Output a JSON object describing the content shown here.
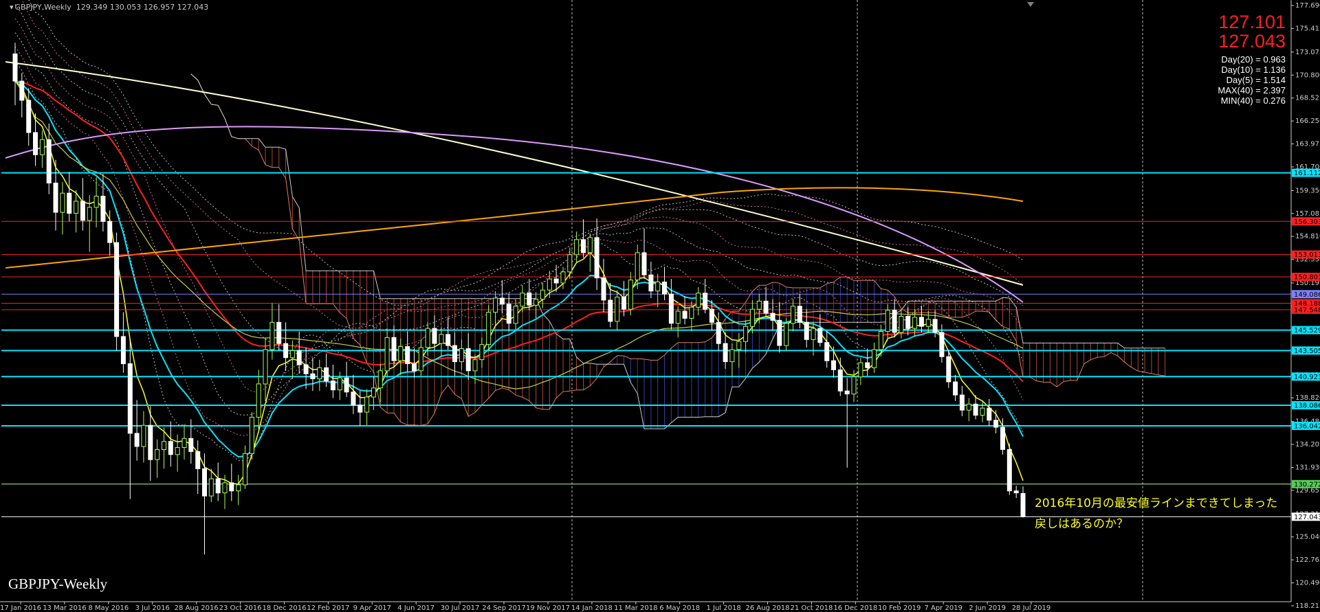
{
  "header": {
    "symbol": "GBPJPY,Weekly",
    "ohlc": "129.349 130.053 126.957 127.043"
  },
  "price_panel": {
    "bid": "127.101",
    "ask": "127.043",
    "stats": [
      "Day(20) = 0.963",
      "Day(10) = 1.136",
      "Day(5) = 1.514",
      "MAX(40) = 2.397",
      "MIN(40) = 0.276"
    ]
  },
  "watermark": "GBPJPY-Weekly",
  "annotations": {
    "line1": "2016年10月の最安値ラインまできてしまった",
    "line2": "戻しはあるのか？"
  },
  "colors": {
    "background": "#000000",
    "bull": "#aaff55",
    "bear": "#ffffff",
    "cyan": "#00e5ff",
    "red_line": "#ff2020",
    "yellow_line": "#ffff20",
    "orange_line": "#ffa500",
    "violet_line": "#dd99ff",
    "cream_line": "#ffffd0",
    "annotation": "#ffff1a"
  },
  "chart_data": {
    "type": "candlestick",
    "title": "GBPJPY,Weekly",
    "ylim": [
      118.0,
      178.0
    ],
    "x_tick_labels": [
      "17 Jan 2016",
      "13 Mar 2016",
      "8 May 2016",
      "3 Jul 2016",
      "28 Aug 2016",
      "23 Oct 2016",
      "18 Dec 2016",
      "12 Feb 2017",
      "9 Apr 2017",
      "4 Jun 2017",
      "30 Jul 2017",
      "24 Sep 2017",
      "19 Nov 2017",
      "14 Jan 2018",
      "11 Mar 2018",
      "6 May 2018",
      "1 Jul 2018",
      "26 Aug 2018",
      "21 Oct 2018",
      "16 Dec 2018",
      "10 Feb 2019",
      "7 Apr 2019",
      "2 Jun 2019",
      "28 Jul 2019"
    ],
    "y_ticks": [
      177.69,
      175.415,
      173.075,
      170.8,
      168.525,
      166.25,
      163.975,
      161.7,
      159.35,
      157.085,
      154.81,
      152.535,
      150.195,
      147.92,
      145.645,
      143.37,
      141.095,
      138.82,
      136.48,
      134.205,
      131.93,
      129.655,
      127.315,
      125.04,
      122.765,
      120.49,
      118.215
    ],
    "horizontal_levels": [
      {
        "price": 161.112,
        "label": "161.112",
        "color": "#00e5ff"
      },
      {
        "price": 156.303,
        "label": "156.303",
        "color": "#ff2020"
      },
      {
        "price": 153.013,
        "label": "153.013",
        "color": "#ff2020"
      },
      {
        "price": 150.801,
        "label": "150.801",
        "color": "#ff2020"
      },
      {
        "price": 149.086,
        "label": "149.086",
        "color": "#7f7fff"
      },
      {
        "price": 148.188,
        "label": "148.188",
        "color": "#ff2020"
      },
      {
        "price": 147.548,
        "label": "147.548",
        "color": "#ff2020"
      },
      {
        "price": 145.529,
        "label": "145.529",
        "color": "#00e5ff"
      },
      {
        "price": 143.505,
        "label": "143.505",
        "color": "#00e5ff"
      },
      {
        "price": 140.921,
        "label": "140.921",
        "color": "#00e5ff"
      },
      {
        "price": 138.086,
        "label": "138.086",
        "color": "#00e5ff"
      },
      {
        "price": 136.042,
        "label": "136.042",
        "color": "#00e5ff"
      },
      {
        "price": 130.272,
        "label": "130.272",
        "color": "#aaffaa"
      },
      {
        "price": 127.043,
        "label": "127.043",
        "color": "#ffffff"
      }
    ],
    "ohlc": [
      [
        172.9,
        174.0,
        167.8,
        170.2
      ],
      [
        170.2,
        171.0,
        166.6,
        168.3
      ],
      [
        168.3,
        169.5,
        163.8,
        165.1
      ],
      [
        165.1,
        167.0,
        161.8,
        162.9
      ],
      [
        162.9,
        165.3,
        161.6,
        164.4
      ],
      [
        164.4,
        166.0,
        159.0,
        160.1
      ],
      [
        160.1,
        162.4,
        155.4,
        157.2
      ],
      [
        157.2,
        160.2,
        155.0,
        159.1
      ],
      [
        159.1,
        161.2,
        156.3,
        157.1
      ],
      [
        157.1,
        159.4,
        155.2,
        158.3
      ],
      [
        158.3,
        160.6,
        155.4,
        156.4
      ],
      [
        156.4,
        158.9,
        153.3,
        157.7
      ],
      [
        157.7,
        160.7,
        155.7,
        158.8
      ],
      [
        158.8,
        161.0,
        155.3,
        156.3
      ],
      [
        156.3,
        157.4,
        152.9,
        154.2
      ],
      [
        154.2,
        155.2,
        143.5,
        144.9
      ],
      [
        144.9,
        147.3,
        141.3,
        142.2
      ],
      [
        142.2,
        144.6,
        128.8,
        135.3
      ],
      [
        135.3,
        138.6,
        132.6,
        134.0
      ],
      [
        134.0,
        137.5,
        132.4,
        136.1
      ],
      [
        136.1,
        138.0,
        130.6,
        132.7
      ],
      [
        132.7,
        134.7,
        130.9,
        133.7
      ],
      [
        133.7,
        135.9,
        131.8,
        134.5
      ],
      [
        134.5,
        136.5,
        132.0,
        133.2
      ],
      [
        133.2,
        135.2,
        131.5,
        133.9
      ],
      [
        133.9,
        136.2,
        132.7,
        134.8
      ],
      [
        134.8,
        136.7,
        132.3,
        133.5
      ],
      [
        133.5,
        134.6,
        129.3,
        131.8
      ],
      [
        131.8,
        133.3,
        123.3,
        129.1
      ],
      [
        129.1,
        131.8,
        128.5,
        130.8
      ],
      [
        130.8,
        132.4,
        128.6,
        129.4
      ],
      [
        129.4,
        131.2,
        127.8,
        130.4
      ],
      [
        130.4,
        132.3,
        128.6,
        129.6
      ],
      [
        129.6,
        131.2,
        128.2,
        130.2
      ],
      [
        130.2,
        134.1,
        129.8,
        133.3
      ],
      [
        133.3,
        137.4,
        132.7,
        136.9
      ],
      [
        136.9,
        141.6,
        135.4,
        140.2
      ],
      [
        140.2,
        144.8,
        138.5,
        143.6
      ],
      [
        143.6,
        148.2,
        142.6,
        146.3
      ],
      [
        146.3,
        148.1,
        143.5,
        144.2
      ],
      [
        144.2,
        146.3,
        141.5,
        142.8
      ],
      [
        142.8,
        144.5,
        140.7,
        143.5
      ],
      [
        143.5,
        145.4,
        141.2,
        142.1
      ],
      [
        142.1,
        143.8,
        139.7,
        141.2
      ],
      [
        141.2,
        142.8,
        139.5,
        140.7
      ],
      [
        140.7,
        142.6,
        139.5,
        141.8
      ],
      [
        141.8,
        143.2,
        139.9,
        140.5
      ],
      [
        140.5,
        142.1,
        138.8,
        139.6
      ],
      [
        139.6,
        141.4,
        138.6,
        140.8
      ],
      [
        140.8,
        142.4,
        138.9,
        139.4
      ],
      [
        139.4,
        141.1,
        137.2,
        138.1
      ],
      [
        138.1,
        139.5,
        136.0,
        137.4
      ],
      [
        137.4,
        139.7,
        136.1,
        138.9
      ],
      [
        138.9,
        141.0,
        137.6,
        139.8
      ],
      [
        139.8,
        142.2,
        138.4,
        141.5
      ],
      [
        141.5,
        145.7,
        140.9,
        144.8
      ],
      [
        144.8,
        146.0,
        141.9,
        142.5
      ],
      [
        142.5,
        144.7,
        141.1,
        143.9
      ],
      [
        143.9,
        145.4,
        141.4,
        142.2
      ],
      [
        142.2,
        143.7,
        140.8,
        141.5
      ],
      [
        141.5,
        144.6,
        141.0,
        143.8
      ],
      [
        143.8,
        146.3,
        143.0,
        145.7
      ],
      [
        145.7,
        147.0,
        143.5,
        144.2
      ],
      [
        144.2,
        145.8,
        142.9,
        145.1
      ],
      [
        145.1,
        146.8,
        143.6,
        144.0
      ],
      [
        144.0,
        145.3,
        141.0,
        142.4
      ],
      [
        142.4,
        144.6,
        141.6,
        143.7
      ],
      [
        143.7,
        145.2,
        140.6,
        141.5
      ],
      [
        141.5,
        143.1,
        140.2,
        142.6
      ],
      [
        142.6,
        144.8,
        141.8,
        144.1
      ],
      [
        144.1,
        148.0,
        143.5,
        147.3
      ],
      [
        147.3,
        149.4,
        146.0,
        148.7
      ],
      [
        148.7,
        150.5,
        147.2,
        148.1
      ],
      [
        148.1,
        149.2,
        145.4,
        146.2
      ],
      [
        146.2,
        148.5,
        145.6,
        147.9
      ],
      [
        147.9,
        150.0,
        147.3,
        149.2
      ],
      [
        149.2,
        150.6,
        147.5,
        148.0
      ],
      [
        148.0,
        149.3,
        146.7,
        148.6
      ],
      [
        148.6,
        150.2,
        147.7,
        149.5
      ],
      [
        149.5,
        151.4,
        148.7,
        150.6
      ],
      [
        150.6,
        152.0,
        149.3,
        150.2
      ],
      [
        150.2,
        151.8,
        149.6,
        151.3
      ],
      [
        151.3,
        153.7,
        150.6,
        153.0
      ],
      [
        153.0,
        155.3,
        152.2,
        154.5
      ],
      [
        154.5,
        156.5,
        152.7,
        153.2
      ],
      [
        153.2,
        155.1,
        151.3,
        154.7
      ],
      [
        154.7,
        156.6,
        149.5,
        150.7
      ],
      [
        150.7,
        152.6,
        147.3,
        148.5
      ],
      [
        148.5,
        150.2,
        145.8,
        146.4
      ],
      [
        146.4,
        149.5,
        145.5,
        148.8
      ],
      [
        148.8,
        150.4,
        146.9,
        147.6
      ],
      [
        147.6,
        151.3,
        147.0,
        150.5
      ],
      [
        150.5,
        154.0,
        149.6,
        153.2
      ],
      [
        153.2,
        155.6,
        150.6,
        151.0
      ],
      [
        151.0,
        152.3,
        148.7,
        149.4
      ],
      [
        149.4,
        151.1,
        147.8,
        150.3
      ],
      [
        150.3,
        151.8,
        148.5,
        149.1
      ],
      [
        149.1,
        150.6,
        145.6,
        146.2
      ],
      [
        146.2,
        147.9,
        144.8,
        147.4
      ],
      [
        147.4,
        148.9,
        146.1,
        146.7
      ],
      [
        146.7,
        148.4,
        145.4,
        147.8
      ],
      [
        147.8,
        149.8,
        147.0,
        149.2
      ],
      [
        149.2,
        150.6,
        147.2,
        147.6
      ],
      [
        147.6,
        148.5,
        145.5,
        146.3
      ],
      [
        146.3,
        147.3,
        143.5,
        144.2
      ],
      [
        144.2,
        145.3,
        141.7,
        142.4
      ],
      [
        142.4,
        144.2,
        140.9,
        143.6
      ],
      [
        143.6,
        145.2,
        141.8,
        144.4
      ],
      [
        144.4,
        146.5,
        143.3,
        145.9
      ],
      [
        145.9,
        148.5,
        145.2,
        147.6
      ],
      [
        147.6,
        149.1,
        146.2,
        148.4
      ],
      [
        148.4,
        149.8,
        146.9,
        147.2
      ],
      [
        147.2,
        148.6,
        145.5,
        146.5
      ],
      [
        146.5,
        148.3,
        143.3,
        144.0
      ],
      [
        144.0,
        146.7,
        143.5,
        146.2
      ],
      [
        146.2,
        148.6,
        145.4,
        147.9
      ],
      [
        147.9,
        149.1,
        145.7,
        146.3
      ],
      [
        146.3,
        147.6,
        143.8,
        144.6
      ],
      [
        144.6,
        146.3,
        143.0,
        145.7
      ],
      [
        145.7,
        147.1,
        143.9,
        144.3
      ],
      [
        144.3,
        145.4,
        141.8,
        142.5
      ],
      [
        142.5,
        143.9,
        140.8,
        141.6
      ],
      [
        141.6,
        142.8,
        139.0,
        139.5
      ],
      [
        139.5,
        140.8,
        131.9,
        139.2
      ],
      [
        139.2,
        141.6,
        138.4,
        140.9
      ],
      [
        140.9,
        142.8,
        140.1,
        142.3
      ],
      [
        142.3,
        143.7,
        141.0,
        141.8
      ],
      [
        141.8,
        144.3,
        141.3,
        143.6
      ],
      [
        143.6,
        146.0,
        142.9,
        145.4
      ],
      [
        145.4,
        148.1,
        144.6,
        147.5
      ],
      [
        147.5,
        148.6,
        144.8,
        145.3
      ],
      [
        145.3,
        147.6,
        144.7,
        146.9
      ],
      [
        146.9,
        147.8,
        145.0,
        145.7
      ],
      [
        145.7,
        147.6,
        144.9,
        146.8
      ],
      [
        146.8,
        147.9,
        145.3,
        145.9
      ],
      [
        145.9,
        147.4,
        145.2,
        146.6
      ],
      [
        146.6,
        147.5,
        144.8,
        145.3
      ],
      [
        145.3,
        146.1,
        142.3,
        142.9
      ],
      [
        142.9,
        143.6,
        139.8,
        140.4
      ],
      [
        140.4,
        141.1,
        138.5,
        139.1
      ],
      [
        139.1,
        140.0,
        137.0,
        137.6
      ],
      [
        137.6,
        138.8,
        136.5,
        138.2
      ],
      [
        138.2,
        139.1,
        136.7,
        137.1
      ],
      [
        137.1,
        138.4,
        136.4,
        137.8
      ],
      [
        137.8,
        138.7,
        136.0,
        136.6
      ],
      [
        136.6,
        137.6,
        135.3,
        135.9
      ],
      [
        135.9,
        136.8,
        133.2,
        133.7
      ],
      [
        133.7,
        134.3,
        129.2,
        129.6
      ],
      [
        129.6,
        130.1,
        128.9,
        129.4
      ],
      [
        129.349,
        130.053,
        126.957,
        127.043
      ]
    ]
  }
}
